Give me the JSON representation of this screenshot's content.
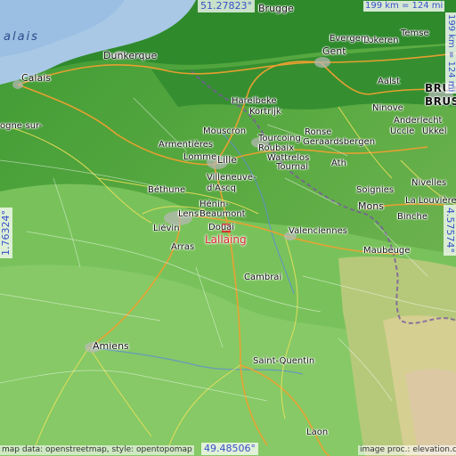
{
  "map": {
    "target": "Lallaing",
    "coords": {
      "top": "51.27823°",
      "bottom": "49.48506°",
      "left": "1.76324°",
      "right": "4.57574°"
    },
    "scale": {
      "horizontal": "199 km = 124 mi",
      "vertical": "199 km = 124 mi"
    },
    "credits": {
      "left": "map data: openstreetmap, style: opentopomap",
      "right": "image proc.: elevation.city"
    },
    "sea_label": "alais",
    "cities": [
      {
        "name": "Brugge",
        "size": "big"
      },
      {
        "name": "Temse"
      },
      {
        "name": "Gent",
        "size": "big"
      },
      {
        "name": "Lokeren"
      },
      {
        "name": "Evergem"
      },
      {
        "name": "Dunkerque",
        "size": "big"
      },
      {
        "name": "Calais",
        "size": "big"
      },
      {
        "name": "ogne-sur-"
      },
      {
        "name": "Aalst"
      },
      {
        "name": "BRUX"
      },
      {
        "name": "BRUS"
      },
      {
        "name": "Ninove"
      },
      {
        "name": "Anderlecht"
      },
      {
        "name": "Uccle"
      },
      {
        "name": "Ukkel"
      },
      {
        "name": "Harelbeke"
      },
      {
        "name": "Kortrijk"
      },
      {
        "name": "Mouscron"
      },
      {
        "name": "Tourcoing"
      },
      {
        "name": "Roubaix"
      },
      {
        "name": "Wattrelos"
      },
      {
        "name": "Ronse"
      },
      {
        "name": "Geraardsbergen"
      },
      {
        "name": "Armentières"
      },
      {
        "name": "Lomme"
      },
      {
        "name": "Lille",
        "size": "big"
      },
      {
        "name": "Ath"
      },
      {
        "name": "Villeneuve-"
      },
      {
        "name": "d'Ascq"
      },
      {
        "name": "Tournai"
      },
      {
        "name": "Nivelles"
      },
      {
        "name": "Béthune"
      },
      {
        "name": "Soignies"
      },
      {
        "name": "La Louvière"
      },
      {
        "name": "Lens"
      },
      {
        "name": "Beaumont"
      },
      {
        "name": "Hénin-"
      },
      {
        "name": "Mons",
        "size": "big"
      },
      {
        "name": "Binche"
      },
      {
        "name": "Liévin"
      },
      {
        "name": "Douai"
      },
      {
        "name": "Valenciennes"
      },
      {
        "name": "Arras"
      },
      {
        "name": "Maubeuge"
      },
      {
        "name": "Cambrai"
      },
      {
        "name": "Amiens",
        "size": "big"
      },
      {
        "name": "Saint-Quentin"
      },
      {
        "name": "Laon"
      }
    ]
  }
}
